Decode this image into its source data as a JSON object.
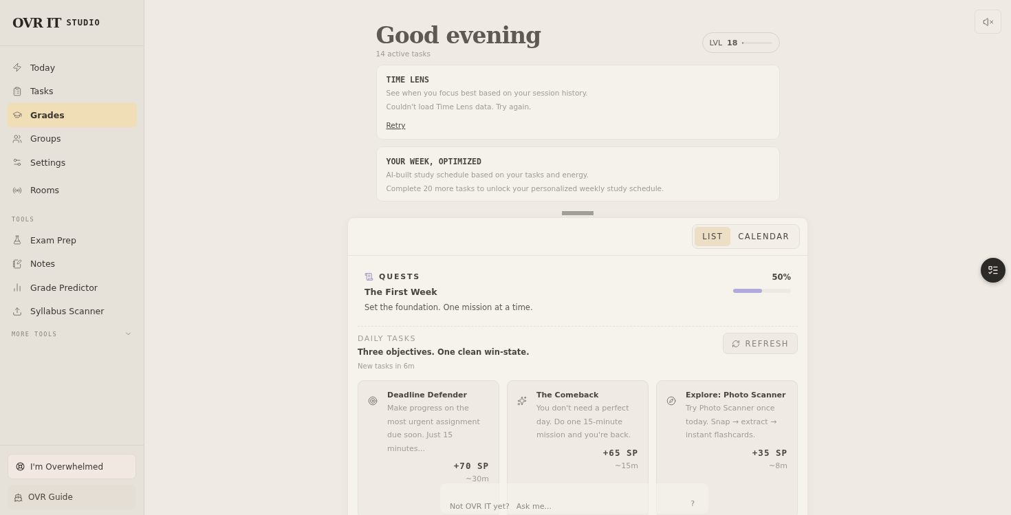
{
  "sidebar": {
    "logo": {
      "title": "OVR IT",
      "subtitle": "STUDIO"
    },
    "items": [
      {
        "kind": "bolt",
        "label": "Today",
        "selected": false
      },
      {
        "kind": "clipboard",
        "label": "Tasks",
        "selected": false
      },
      {
        "kind": "cap",
        "label": "Grades",
        "selected": true
      },
      {
        "kind": "users",
        "label": "Groups",
        "selected": false
      },
      {
        "kind": "sliders",
        "label": "Settings",
        "selected": false
      },
      {
        "kind": "radio",
        "label": "Rooms",
        "selected": false
      }
    ],
    "tools_heading": "TOOLS",
    "tools": [
      {
        "kind": "flask",
        "label": "Exam Prep"
      },
      {
        "kind": "notes",
        "label": "Notes"
      },
      {
        "kind": "chart",
        "label": "Grade Predictor"
      },
      {
        "kind": "upload",
        "label": "Syllabus Scanner"
      }
    ],
    "more_tools": "MORE TOOLS",
    "overwhelmed_button": "I'm Overwhelmed",
    "guide_button": "OVR Guide"
  },
  "header": {
    "greeting": "Good evening",
    "subtitle": "14 active tasks",
    "level_label": "LVL",
    "level_value": "18",
    "level": 0.03
  },
  "cards": [
    {
      "kind": "retry",
      "title": "TIME LENS",
      "lines": [
        "See when you focus best based on your session history.",
        "Couldn't load Time Lens data. Try again."
      ],
      "link": "Retry"
    },
    {
      "kind": "plain",
      "title": "YOUR WEEK, OPTIMIZED",
      "lines": [
        "AI-built study schedule based on your tasks and energy.",
        "Complete 20 more tasks to unlock your personalized weekly study schedule."
      ]
    }
  ],
  "view_tabs": [
    {
      "label": "LIST",
      "selected": true
    },
    {
      "label": "CALENDAR",
      "selected": false
    }
  ],
  "quests": {
    "heading": "QUESTS",
    "title": "The First Week",
    "description": "Set the foundation. One mission at a time.",
    "percent": "50%",
    "level": 0.5
  },
  "daily": {
    "heading": "DAILY TASKS",
    "title": "Three objectives. One clean win-state.",
    "note": "New tasks in 6m",
    "refresh": "REFRESH",
    "tasks": [
      {
        "kind": "target",
        "title": "Deadline Defender",
        "description": "Make progress on the most urgent assignment due soon. Just 15 minutes...",
        "points": "+70 SP",
        "time": "~30m"
      },
      {
        "kind": "sparkle",
        "title": "The Comeback",
        "description": "You don't need a perfect day. Do one 15-minute mission and you're back.",
        "points": "+65 SP",
        "time": "~15m"
      },
      {
        "kind": "compass",
        "title": "Explore: Photo Scanner",
        "description": "Try Photo Scanner once today. Snap → extract → instant flashcards.",
        "points": "+35 SP",
        "time": "~8m"
      }
    ]
  },
  "chat": {
    "label": "Not OVR IT yet?",
    "placeholder": "Ask me...",
    "help": "?"
  }
}
